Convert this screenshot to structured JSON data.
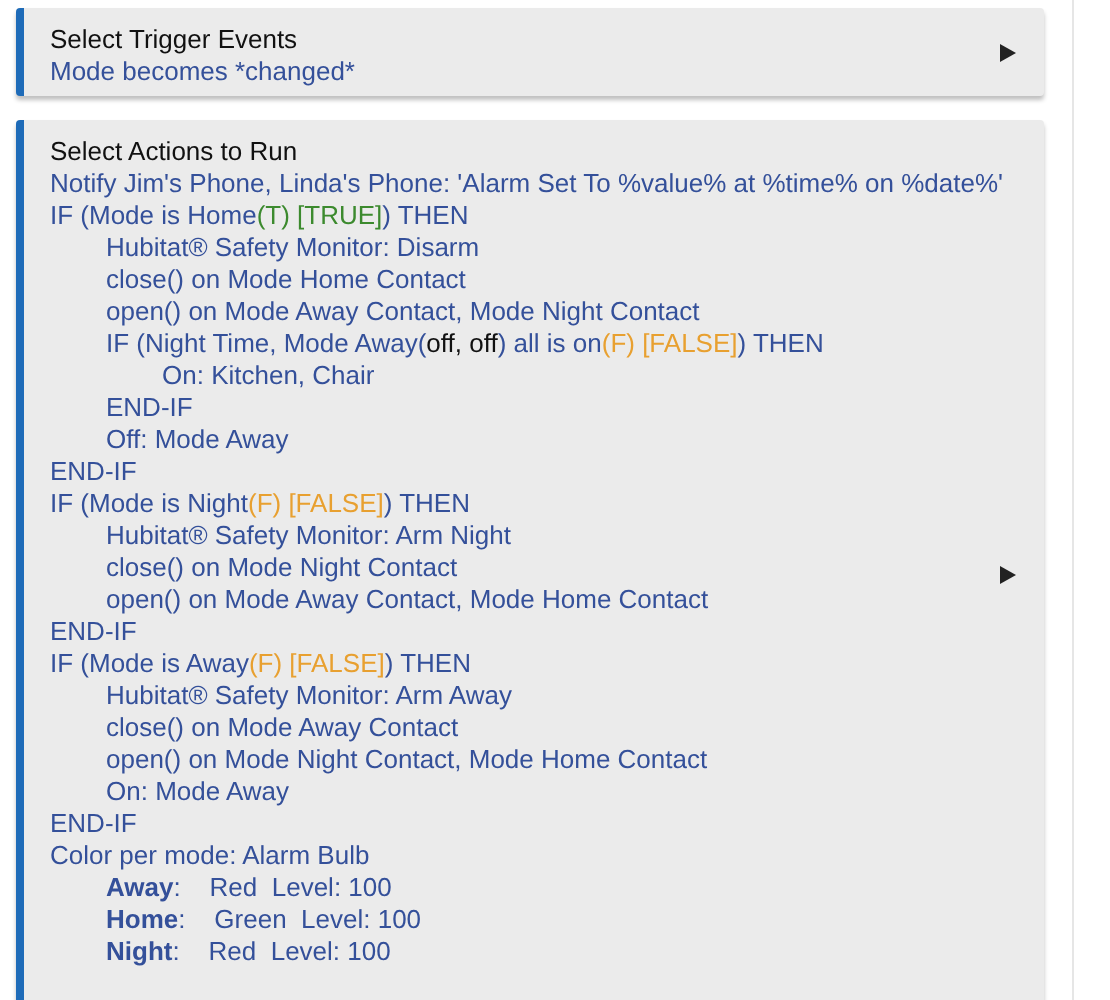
{
  "sections": [
    {
      "title": "Select Trigger Events",
      "lines": [
        {
          "segments": [
            {
              "kind": "plain",
              "text": "Mode becomes *changed*"
            }
          ]
        }
      ]
    },
    {
      "title": "Select Actions to Run",
      "lines": [
        {
          "segments": [
            {
              "kind": "plain",
              "text": "Notify Jim's Phone, Linda's Phone: 'Alarm Set To %value% at %time% on %date%'"
            }
          ]
        },
        {
          "segments": [
            {
              "kind": "plain",
              "text": "IF (Mode is Home"
            },
            {
              "kind": "true",
              "text": "(T) [TRUE]"
            },
            {
              "kind": "plain",
              "text": ") THEN"
            }
          ],
          "children": [
            {
              "segments": [
                {
                  "kind": "plain",
                  "text": "Hubitat® Safety Monitor: Disarm"
                }
              ]
            },
            {
              "segments": [
                {
                  "kind": "plain",
                  "text": "close() on Mode Home Contact"
                }
              ]
            },
            {
              "segments": [
                {
                  "kind": "plain",
                  "text": "open() on Mode Away Contact, Mode Night Contact"
                }
              ]
            },
            {
              "segments": [
                {
                  "kind": "plain",
                  "text": "IF (Night Time, Mode Away("
                },
                {
                  "kind": "value",
                  "text": "off, off"
                },
                {
                  "kind": "plain",
                  "text": ") all is on"
                },
                {
                  "kind": "false",
                  "text": "(F) [FALSE]"
                },
                {
                  "kind": "plain",
                  "text": ") THEN"
                }
              ],
              "children": [
                {
                  "segments": [
                    {
                      "kind": "plain",
                      "text": "On: Kitchen, Chair"
                    }
                  ]
                }
              ]
            },
            {
              "segments": [
                {
                  "kind": "plain",
                  "text": "END-IF"
                }
              ]
            },
            {
              "segments": [
                {
                  "kind": "plain",
                  "text": "Off: Mode Away"
                }
              ]
            }
          ]
        },
        {
          "segments": [
            {
              "kind": "plain",
              "text": "END-IF"
            }
          ]
        },
        {
          "segments": [
            {
              "kind": "plain",
              "text": "IF (Mode is Night"
            },
            {
              "kind": "false",
              "text": "(F) [FALSE]"
            },
            {
              "kind": "plain",
              "text": ") THEN"
            }
          ],
          "children": [
            {
              "segments": [
                {
                  "kind": "plain",
                  "text": "Hubitat® Safety Monitor: Arm Night"
                }
              ]
            },
            {
              "segments": [
                {
                  "kind": "plain",
                  "text": "close() on Mode Night Contact"
                }
              ]
            },
            {
              "segments": [
                {
                  "kind": "plain",
                  "text": "open() on Mode Away Contact, Mode Home Contact"
                }
              ]
            }
          ]
        },
        {
          "segments": [
            {
              "kind": "plain",
              "text": "END-IF"
            }
          ]
        },
        {
          "segments": [
            {
              "kind": "plain",
              "text": "IF (Mode is Away"
            },
            {
              "kind": "false",
              "text": "(F) [FALSE]"
            },
            {
              "kind": "plain",
              "text": ") THEN"
            }
          ],
          "children": [
            {
              "segments": [
                {
                  "kind": "plain",
                  "text": "Hubitat® Safety Monitor: Arm Away"
                }
              ]
            },
            {
              "segments": [
                {
                  "kind": "plain",
                  "text": "close() on Mode Away Contact"
                }
              ]
            },
            {
              "segments": [
                {
                  "kind": "plain",
                  "text": "open() on Mode Night Contact, Mode Home Contact"
                }
              ]
            },
            {
              "segments": [
                {
                  "kind": "plain",
                  "text": "On: Mode Away"
                }
              ]
            }
          ]
        },
        {
          "segments": [
            {
              "kind": "plain",
              "text": "END-IF"
            }
          ]
        },
        {
          "segments": [
            {
              "kind": "plain",
              "text": "Color per mode: Alarm Bulb"
            }
          ],
          "children": [
            {
              "segments": [
                {
                  "kind": "bold",
                  "text": "Away"
                },
                {
                  "kind": "plain",
                  "text": ":    Red  Level: 100"
                }
              ]
            },
            {
              "segments": [
                {
                  "kind": "bold",
                  "text": "Home"
                },
                {
                  "kind": "plain",
                  "text": ":    Green  Level: 100"
                }
              ]
            },
            {
              "segments": [
                {
                  "kind": "bold",
                  "text": "Night"
                },
                {
                  "kind": "plain",
                  "text": ":    Red  Level: 100"
                }
              ]
            }
          ]
        }
      ]
    }
  ]
}
